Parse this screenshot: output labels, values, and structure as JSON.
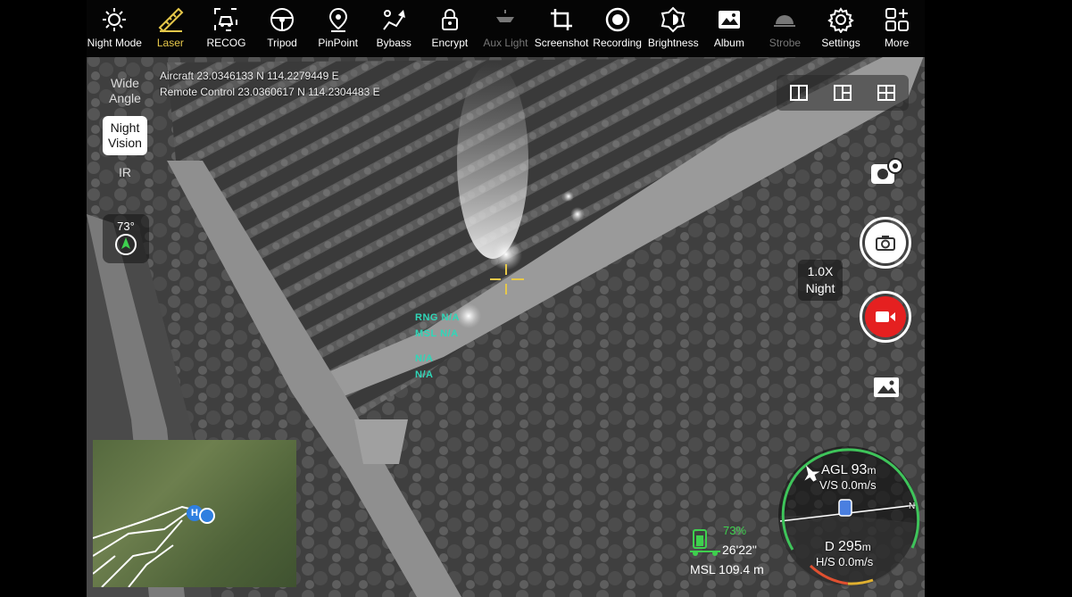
{
  "toolbar": {
    "items": [
      {
        "label": "Night Mode",
        "icon": "sun-icon",
        "state": "normal"
      },
      {
        "label": "Laser",
        "icon": "ruler-icon",
        "state": "active"
      },
      {
        "label": "RECOG",
        "icon": "car-recognition-icon",
        "state": "normal"
      },
      {
        "label": "Tripod",
        "icon": "steering-wheel-icon",
        "state": "normal"
      },
      {
        "label": "PinPoint",
        "icon": "location-pin-icon",
        "state": "normal"
      },
      {
        "label": "Bybass",
        "icon": "bypass-arrows-icon",
        "state": "normal"
      },
      {
        "label": "Encrypt",
        "icon": "lock-icon",
        "state": "normal"
      },
      {
        "label": "Aux Light",
        "icon": "aux-light-icon",
        "state": "disabled"
      },
      {
        "label": "Screenshot",
        "icon": "crop-icon",
        "state": "normal"
      },
      {
        "label": "Recording",
        "icon": "record-circle-icon",
        "state": "normal"
      },
      {
        "label": "Brightness",
        "icon": "brightness-icon",
        "state": "normal"
      },
      {
        "label": "Album",
        "icon": "image-icon",
        "state": "normal"
      },
      {
        "label": "Strobe",
        "icon": "strobe-icon",
        "state": "disabled"
      },
      {
        "label": "Settings",
        "icon": "gear-icon",
        "state": "normal"
      },
      {
        "label": "More",
        "icon": "grid-plus-icon",
        "state": "normal"
      }
    ]
  },
  "lens": {
    "options": [
      {
        "label": "Wide Angle",
        "selected": false
      },
      {
        "label": "Night Vision",
        "selected": true
      },
      {
        "label": "IR",
        "selected": false
      }
    ]
  },
  "coords": {
    "aircraft": "Aircraft 23.0346133 N 114.2279449 E",
    "remote": "Remote Control 23.0360617 N 114.2304483 E"
  },
  "compass_mini": {
    "heading": "73°"
  },
  "zoom": {
    "level": "1.0X",
    "mode": "Night"
  },
  "laser": {
    "rng": "RNG N/A",
    "msl": "MSL N/A",
    "lat": "N/A",
    "lon": "N/A"
  },
  "battery": {
    "percent": "73%",
    "time": "26'22\"",
    "msl": "MSL 109.4 m"
  },
  "hud": {
    "agl_label": "AGL",
    "agl_value": "93",
    "agl_unit": "m",
    "vs": "V/S 0.0m/s",
    "d_label": "D",
    "d_value": "295",
    "d_unit": "m",
    "hs": "H/S 0.0m/s",
    "north": "N"
  },
  "minimap": {
    "home": "H"
  },
  "colors": {
    "accent": "#e6c84a",
    "laser_text": "#2fd7b8",
    "battery": "#3ed04e",
    "record": "#e52020",
    "hud_ring": "#3ec45a"
  }
}
